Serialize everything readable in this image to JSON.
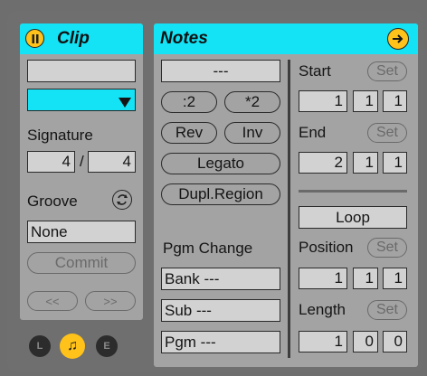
{
  "clip": {
    "title": "Clip",
    "name_value": "",
    "color_value": "",
    "signature_label": "Signature",
    "sig_numerator": "4",
    "sig_separator": "/",
    "sig_denominator": "4",
    "groove_label": "Groove",
    "groove_value": "None",
    "commit_label": "Commit",
    "nudge_back_label": "<<",
    "nudge_fwd_label": ">>"
  },
  "tabs": {
    "launch": "L",
    "notes": "♫",
    "envelopes": "E"
  },
  "notes": {
    "title": "Notes",
    "transpose_value": "---",
    "half_label": ":2",
    "double_label": "*2",
    "rev_label": "Rev",
    "inv_label": "Inv",
    "legato_label": "Legato",
    "dupl_label": "Dupl.Region",
    "pgm_change_label": "Pgm Change",
    "bank_value": "Bank ---",
    "sub_value": "Sub ---",
    "pgm_value": "Pgm ---",
    "start_label": "Start",
    "start_bar": "1",
    "start_beat": "1",
    "start_sixteenth": "1",
    "end_label": "End",
    "end_bar": "2",
    "end_beat": "1",
    "end_sixteenth": "1",
    "loop_label": "Loop",
    "position_label": "Position",
    "position_bar": "1",
    "position_beat": "1",
    "position_sixteenth": "1",
    "length_label": "Length",
    "length_bar": "1",
    "length_beat": "0",
    "length_sixteenth": "0",
    "set_label": "Set"
  },
  "colors": {
    "header": "#13e3f5",
    "panel": "#a3a3a3",
    "accent": "#ffc21a"
  }
}
